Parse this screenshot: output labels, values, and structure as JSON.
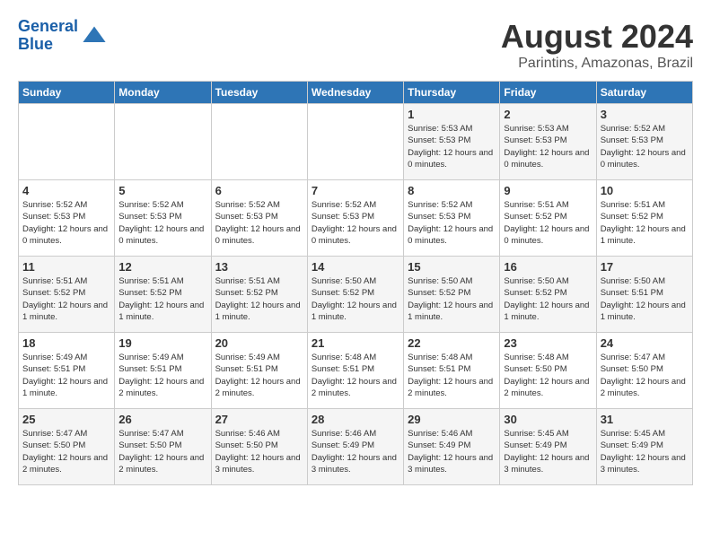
{
  "header": {
    "logo_line1": "General",
    "logo_line2": "Blue",
    "main_title": "August 2024",
    "subtitle": "Parintins, Amazonas, Brazil"
  },
  "days_of_week": [
    "Sunday",
    "Monday",
    "Tuesday",
    "Wednesday",
    "Thursday",
    "Friday",
    "Saturday"
  ],
  "weeks": [
    [
      {
        "day": "",
        "info": ""
      },
      {
        "day": "",
        "info": ""
      },
      {
        "day": "",
        "info": ""
      },
      {
        "day": "",
        "info": ""
      },
      {
        "day": "1",
        "info": "Sunrise: 5:53 AM\nSunset: 5:53 PM\nDaylight: 12 hours and 0 minutes."
      },
      {
        "day": "2",
        "info": "Sunrise: 5:53 AM\nSunset: 5:53 PM\nDaylight: 12 hours and 0 minutes."
      },
      {
        "day": "3",
        "info": "Sunrise: 5:52 AM\nSunset: 5:53 PM\nDaylight: 12 hours and 0 minutes."
      }
    ],
    [
      {
        "day": "4",
        "info": "Sunrise: 5:52 AM\nSunset: 5:53 PM\nDaylight: 12 hours and 0 minutes."
      },
      {
        "day": "5",
        "info": "Sunrise: 5:52 AM\nSunset: 5:53 PM\nDaylight: 12 hours and 0 minutes."
      },
      {
        "day": "6",
        "info": "Sunrise: 5:52 AM\nSunset: 5:53 PM\nDaylight: 12 hours and 0 minutes."
      },
      {
        "day": "7",
        "info": "Sunrise: 5:52 AM\nSunset: 5:53 PM\nDaylight: 12 hours and 0 minutes."
      },
      {
        "day": "8",
        "info": "Sunrise: 5:52 AM\nSunset: 5:53 PM\nDaylight: 12 hours and 0 minutes."
      },
      {
        "day": "9",
        "info": "Sunrise: 5:51 AM\nSunset: 5:52 PM\nDaylight: 12 hours and 0 minutes."
      },
      {
        "day": "10",
        "info": "Sunrise: 5:51 AM\nSunset: 5:52 PM\nDaylight: 12 hours and 1 minute."
      }
    ],
    [
      {
        "day": "11",
        "info": "Sunrise: 5:51 AM\nSunset: 5:52 PM\nDaylight: 12 hours and 1 minute."
      },
      {
        "day": "12",
        "info": "Sunrise: 5:51 AM\nSunset: 5:52 PM\nDaylight: 12 hours and 1 minute."
      },
      {
        "day": "13",
        "info": "Sunrise: 5:51 AM\nSunset: 5:52 PM\nDaylight: 12 hours and 1 minute."
      },
      {
        "day": "14",
        "info": "Sunrise: 5:50 AM\nSunset: 5:52 PM\nDaylight: 12 hours and 1 minute."
      },
      {
        "day": "15",
        "info": "Sunrise: 5:50 AM\nSunset: 5:52 PM\nDaylight: 12 hours and 1 minute."
      },
      {
        "day": "16",
        "info": "Sunrise: 5:50 AM\nSunset: 5:52 PM\nDaylight: 12 hours and 1 minute."
      },
      {
        "day": "17",
        "info": "Sunrise: 5:50 AM\nSunset: 5:51 PM\nDaylight: 12 hours and 1 minute."
      }
    ],
    [
      {
        "day": "18",
        "info": "Sunrise: 5:49 AM\nSunset: 5:51 PM\nDaylight: 12 hours and 1 minute."
      },
      {
        "day": "19",
        "info": "Sunrise: 5:49 AM\nSunset: 5:51 PM\nDaylight: 12 hours and 2 minutes."
      },
      {
        "day": "20",
        "info": "Sunrise: 5:49 AM\nSunset: 5:51 PM\nDaylight: 12 hours and 2 minutes."
      },
      {
        "day": "21",
        "info": "Sunrise: 5:48 AM\nSunset: 5:51 PM\nDaylight: 12 hours and 2 minutes."
      },
      {
        "day": "22",
        "info": "Sunrise: 5:48 AM\nSunset: 5:51 PM\nDaylight: 12 hours and 2 minutes."
      },
      {
        "day": "23",
        "info": "Sunrise: 5:48 AM\nSunset: 5:50 PM\nDaylight: 12 hours and 2 minutes."
      },
      {
        "day": "24",
        "info": "Sunrise: 5:47 AM\nSunset: 5:50 PM\nDaylight: 12 hours and 2 minutes."
      }
    ],
    [
      {
        "day": "25",
        "info": "Sunrise: 5:47 AM\nSunset: 5:50 PM\nDaylight: 12 hours and 2 minutes."
      },
      {
        "day": "26",
        "info": "Sunrise: 5:47 AM\nSunset: 5:50 PM\nDaylight: 12 hours and 2 minutes."
      },
      {
        "day": "27",
        "info": "Sunrise: 5:46 AM\nSunset: 5:50 PM\nDaylight: 12 hours and 3 minutes."
      },
      {
        "day": "28",
        "info": "Sunrise: 5:46 AM\nSunset: 5:49 PM\nDaylight: 12 hours and 3 minutes."
      },
      {
        "day": "29",
        "info": "Sunrise: 5:46 AM\nSunset: 5:49 PM\nDaylight: 12 hours and 3 minutes."
      },
      {
        "day": "30",
        "info": "Sunrise: 5:45 AM\nSunset: 5:49 PM\nDaylight: 12 hours and 3 minutes."
      },
      {
        "day": "31",
        "info": "Sunrise: 5:45 AM\nSunset: 5:49 PM\nDaylight: 12 hours and 3 minutes."
      }
    ]
  ]
}
